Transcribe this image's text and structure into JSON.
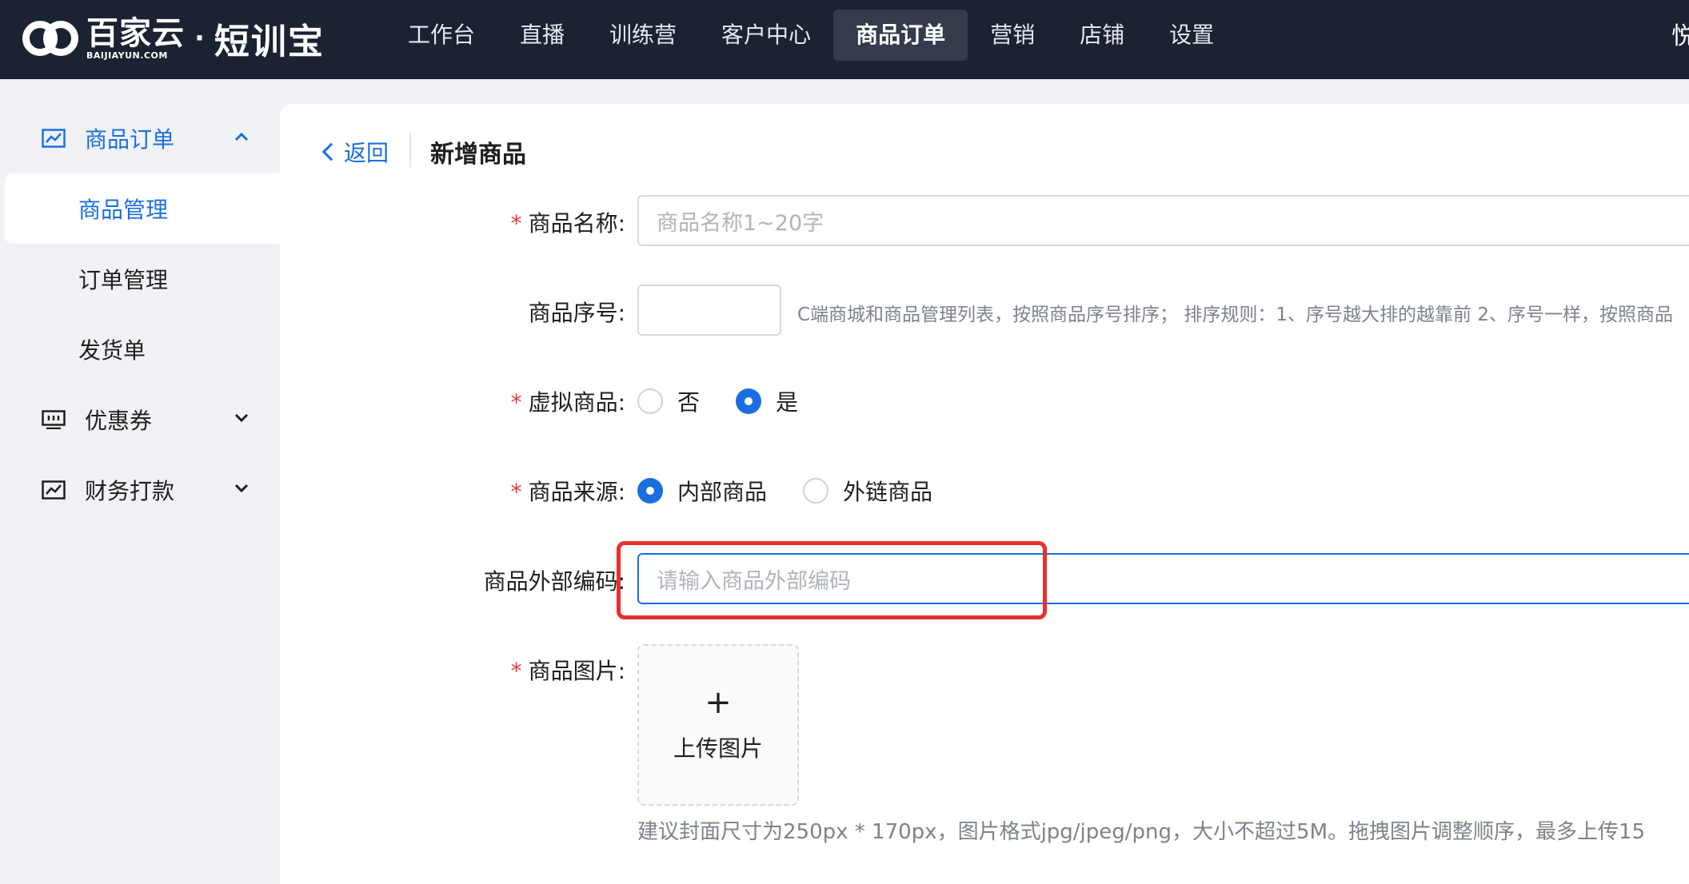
{
  "brand": {
    "company_cn": "百家云",
    "company_en": "BAIJIAYUN.COM",
    "separator": "·",
    "product": "短训宝"
  },
  "nav": {
    "items": [
      "工作台",
      "直播",
      "训练营",
      "客户中心",
      "商品订单",
      "营销",
      "店铺",
      "设置"
    ],
    "active": "商品订单",
    "user_fragment": "悦"
  },
  "sidebar": {
    "groups": [
      {
        "label": "商品订单",
        "icon": "chart-icon",
        "expanded": true
      },
      {
        "label": "优惠券",
        "icon": "monitor-icon",
        "expanded": false
      },
      {
        "label": "财务打款",
        "icon": "chart-icon",
        "expanded": false
      }
    ],
    "sub_items": [
      "商品管理",
      "订单管理",
      "发货单"
    ],
    "active_sub": "商品管理"
  },
  "header": {
    "back_label": "返回",
    "title": "新增商品"
  },
  "form": {
    "name": {
      "label": "商品名称:",
      "required": true,
      "placeholder": "商品名称1~20字",
      "value": ""
    },
    "sort": {
      "label": "商品序号:",
      "required": false,
      "value": "",
      "hint": "C端商城和商品管理列表，按照商品序号排序； 排序规则：1、序号越大排的越靠前 2、序号一样，按照商品"
    },
    "virtual": {
      "label": "虚拟商品:",
      "required": true,
      "options": [
        "否",
        "是"
      ],
      "selected": "是"
    },
    "source": {
      "label": "商品来源:",
      "required": true,
      "options": [
        "内部商品",
        "外链商品"
      ],
      "selected": "内部商品"
    },
    "external_code": {
      "label": "商品外部编码:",
      "required": false,
      "placeholder": "请输入商品外部编码",
      "value": ""
    },
    "image": {
      "label": "商品图片:",
      "required": true,
      "upload_label": "上传图片",
      "hint": "建议封面尺寸为250px * 170px，图片格式jpg/jpeg/png，大小不超过5M。拖拽图片调整顺序，最多上传15"
    }
  },
  "colors": {
    "topbar": "#1b2232",
    "accent": "#1a6fe0",
    "required": "#e6393d",
    "highlight": "#e8302d"
  }
}
